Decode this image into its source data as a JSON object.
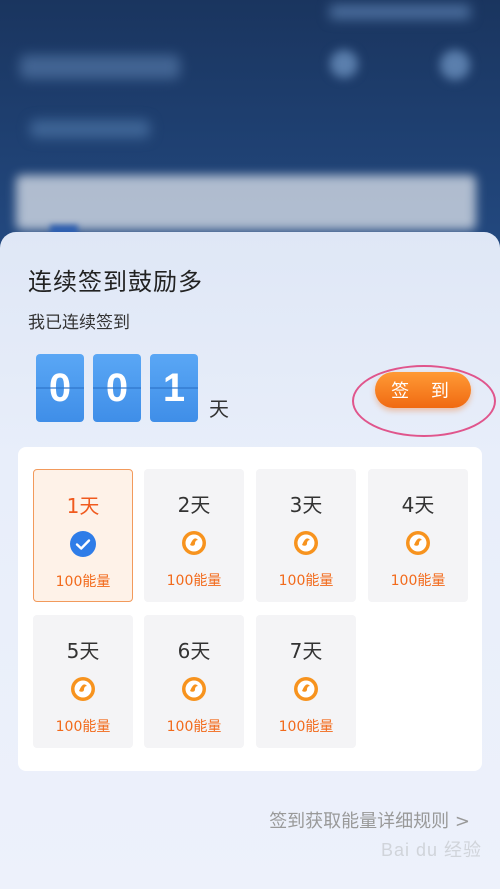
{
  "title": "连续签到鼓励多",
  "subtitle": "我已连续签到",
  "counter": {
    "digits": [
      "0",
      "0",
      "1"
    ],
    "unit": "天"
  },
  "signin_button": "签 到",
  "days": [
    {
      "label": "1天",
      "reward": "100能量",
      "state": "checked"
    },
    {
      "label": "2天",
      "reward": "100能量",
      "state": "pending"
    },
    {
      "label": "3天",
      "reward": "100能量",
      "state": "pending"
    },
    {
      "label": "4天",
      "reward": "100能量",
      "state": "pending"
    },
    {
      "label": "5天",
      "reward": "100能量",
      "state": "pending"
    },
    {
      "label": "6天",
      "reward": "100能量",
      "state": "pending"
    },
    {
      "label": "7天",
      "reward": "100能量",
      "state": "pending"
    }
  ],
  "rules_link": "签到获取能量详细规则 >",
  "watermark": "Bai du 经验",
  "colors": {
    "accent_orange": "#f26a1b",
    "digit_blue": "#4a98ee",
    "check_blue": "#2f7de8",
    "highlight_ring": "#e0558c"
  }
}
